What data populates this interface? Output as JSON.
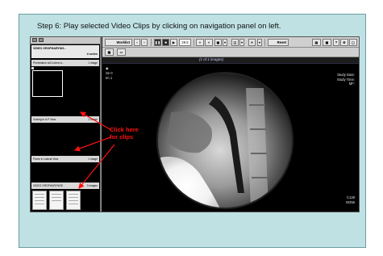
{
  "caption": "Step 6: Play selected Video Clips by clicking on navigation panel on left.",
  "annotation": {
    "line1": "Click here",
    "line2": "for clips",
    "color": "#ff1111"
  },
  "nav_panel": {
    "series_title": "VIDEO OROPHARYNG...",
    "series_count": "4 series",
    "clips": [
      {
        "name": "Penetration w/D.rdrew w...",
        "count": "1 image"
      },
      {
        "name": "Voicing in A-P View",
        "count": "1 image"
      },
      {
        "name": "Puree in Lateral View",
        "count": "1 image"
      },
      {
        "name": "VIDEO OROPHARYNGE",
        "count": "3 images"
      }
    ]
  },
  "toolbar": {
    "worklist_label": "Worklist",
    "zoom_value": "29.5",
    "reset_label": "Reset"
  },
  "viewer": {
    "image_counter": "(1 of 1 images)",
    "left_overlay": [
      "Se 0",
      "Im 1"
    ],
    "right_overlay": [
      "Study Date:",
      "Study Time:",
      "MF:"
    ],
    "bottom_right": [
      "C128",
      "W256"
    ]
  },
  "colors": {
    "slide_bg": "#bfe1e4",
    "panel_bg": "#000000",
    "toolbar_bg": "#cfcfcf"
  }
}
